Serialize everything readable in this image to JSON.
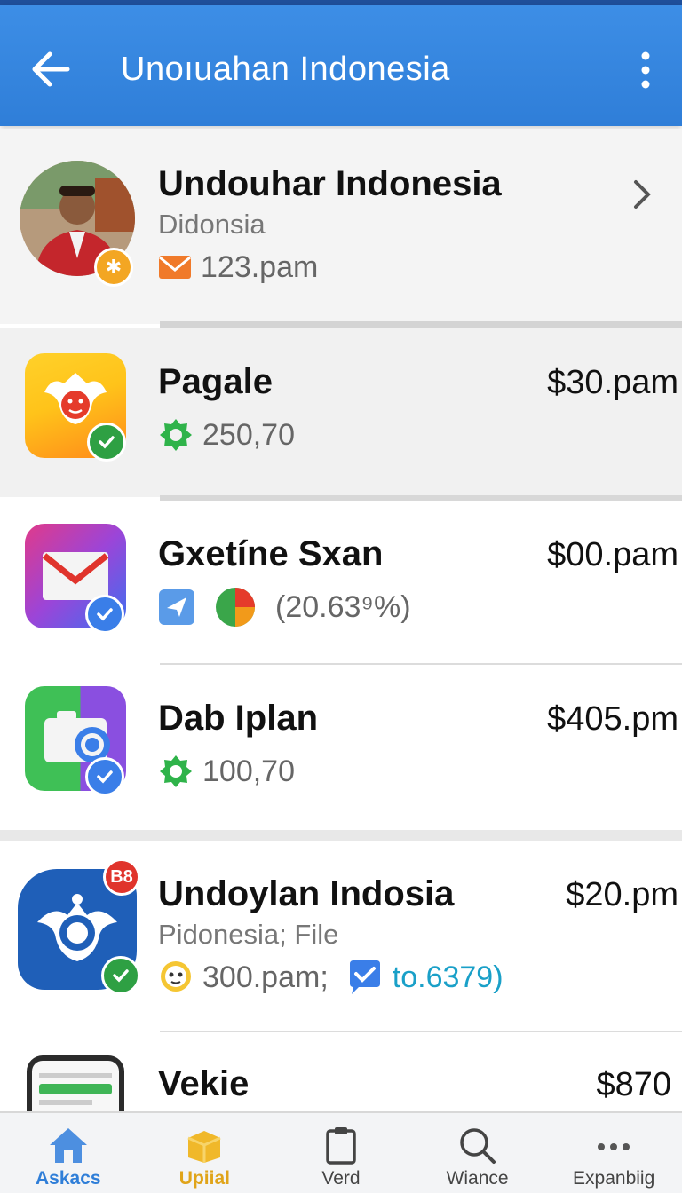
{
  "appbar": {
    "title": "Unoıuahan Indonesia"
  },
  "items": [
    {
      "name": "Undouhar Indonesia",
      "sub": "Didonsia",
      "meta": "123.pam",
      "price": ""
    },
    {
      "name": "Pagale",
      "sub": "",
      "meta": "250,70",
      "price": "$30.pam"
    },
    {
      "name": "Gxetíne Sxan",
      "sub": "",
      "meta": "(20.63⁹%)",
      "price": "$00.pam"
    },
    {
      "name": "Dab Iplan",
      "sub": "",
      "meta": "100,70",
      "price": "$405.pm"
    },
    {
      "name": "Undoylan Indosia",
      "sub": "Pidonesia; File",
      "meta": "300.pam;",
      "meta2": "to.6379)",
      "badge": "B8",
      "price": "$20.pm"
    },
    {
      "name": "Vekie",
      "sub": "",
      "meta": "",
      "price": "$870"
    }
  ],
  "nav": [
    {
      "label": "Askacs",
      "icon": "home-icon"
    },
    {
      "label": "Upiial",
      "icon": "box-icon"
    },
    {
      "label": "Verd",
      "icon": "clipboard-icon"
    },
    {
      "label": "Wiance",
      "icon": "search-icon"
    },
    {
      "label": "Expanbiig",
      "icon": "more-horizontal-icon"
    }
  ],
  "colors": {
    "appbar": "#2f7ed8",
    "nav_active_1": "#2f7ed8",
    "nav_active_2": "#f0b82a"
  }
}
